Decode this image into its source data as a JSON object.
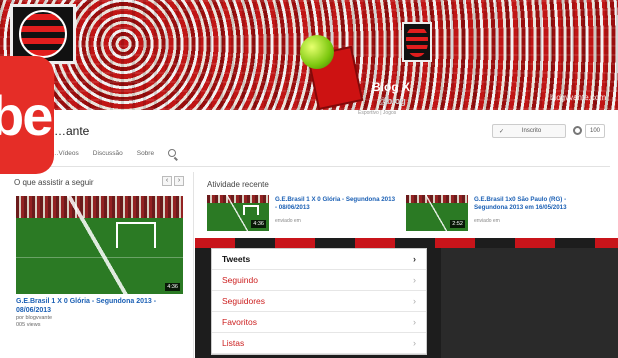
{
  "channel": {
    "name": "…ante",
    "tabs": [
      "…Vídeos",
      "Discussão",
      "Sobre"
    ],
    "subscribe_label": "Inscrito",
    "subscriber_count": "100",
    "banner_watermark": "blogvvante.com"
  },
  "youtube_logo_text": "be",
  "left": {
    "section_title": "O que assistir a seguir",
    "prev_label": "‹",
    "next_label": "›",
    "video": {
      "title": "G.E.Brasil 1 X 0 Glória - Segundona 2013 - 08/06/2013",
      "author": "por blogvvante",
      "views": "005 views",
      "duration": "4:36"
    }
  },
  "activity": {
    "section_title": "Atividade recente",
    "items": [
      {
        "title": "G.E.Brasil 1 X 0 Glória - Segundona 2013 - 08/06/2013",
        "meta": "enviado em",
        "duration": "4:36"
      },
      {
        "title": "G.E.Brasil 1x0 São Paulo (RG) - Segundona 2013 em 16/05/2013",
        "meta": "enviado em",
        "duration": "2:52"
      }
    ]
  },
  "twitter": {
    "menu": [
      {
        "label": "Tweets",
        "active": true
      },
      {
        "label": "Seguindo",
        "active": false
      },
      {
        "label": "Seguidores",
        "active": false
      },
      {
        "label": "Favoritos",
        "active": false
      },
      {
        "label": "Listas",
        "active": false
      }
    ],
    "profile_name": "Blog X",
    "profile_handle": "@blog",
    "profile_small": "Esportivo | Jogos"
  },
  "colors": {
    "youtube_red": "#e52d27",
    "link_blue": "#1a5fb4",
    "twitter_red": "#cc1f1f"
  }
}
